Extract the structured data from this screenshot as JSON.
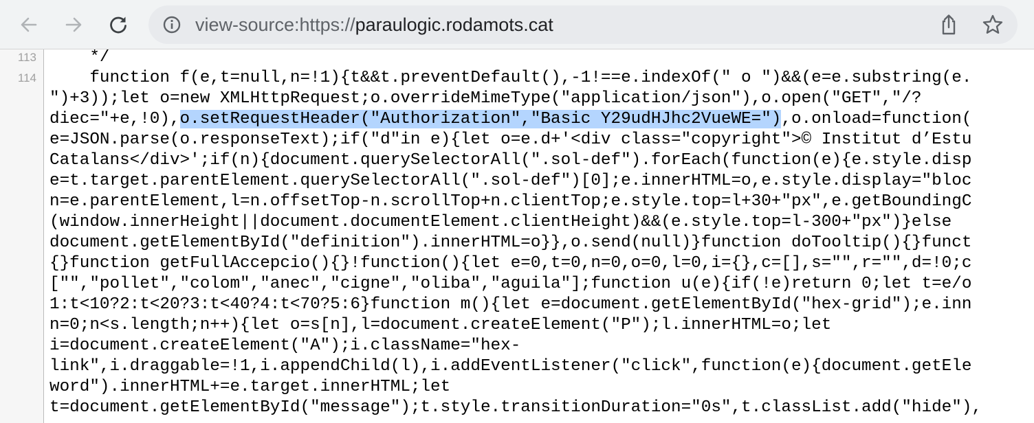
{
  "toolbar": {
    "back_icon": "arrow-left-icon",
    "forward_icon": "arrow-right-icon",
    "reload_icon": "reload-icon"
  },
  "omnibox": {
    "info_icon": "info-icon",
    "url_prefix": "view-source:https://",
    "url_host": "paraulogic.rodamots.cat",
    "share_icon": "share-icon",
    "star_icon": "star-icon"
  },
  "source": {
    "line_numbers": [
      "113",
      "114"
    ],
    "lines": [
      "    */",
      "    function f(e,t=null,n=!1){t&&t.preventDefault(),-1!==e.indexOf(\" o \")&&(e=e.substring(e.",
      "\")+3));let o=new XMLHttpRequest;o.overrideMimeType(\"application/json\"),o.open(\"GET\",\"/?",
      "diec=\"+e,!0),",
      "e=JSON.parse(o.responseText);if(\"d\"in e){let o=e.d+'<div class=\"copyright\">© Institut d’Estu",
      "Catalans</div>';if(n){document.querySelectorAll(\".sol-def\").forEach(function(e){e.style.disp",
      "e=t.target.parentElement.querySelectorAll(\".sol-def\")[0];e.innerHTML=o,e.style.display=\"bloc",
      "n=e.parentElement,l=n.offsetTop-n.scrollTop+n.clientTop;e.style.top=l+30+\"px\",e.getBoundingC",
      "(window.innerHeight||document.documentElement.clientHeight)&&(e.style.top=l-300+\"px\")}else",
      "document.getElementById(\"definition\").innerHTML=o}},o.send(null)}function doTooltip(){}funct",
      "{}function getFullAccepcio(){}!function(){let e=0,t=0,n=0,o=0,l=0,i={},c=[],s=\"\",r=\"\",d=!0;c",
      "[\"\",\"pollet\",\"colom\",\"anec\",\"cigne\",\"oliba\",\"aguila\"];function u(e){if(!e)return 0;let t=e/o",
      "1:t<10?2:t<20?3:t<40?4:t<70?5:6}function m(){let e=document.getElementById(\"hex-grid\");e.inn",
      "n=0;n<s.length;n++){let o=s[n],l=document.createElement(\"P\");l.innerHTML=o;let",
      "i=document.createElement(\"A\");i.className=\"hex-",
      "link\",i.draggable=!1,i.appendChild(l),i.addEventListener(\"click\",function(e){document.getEle",
      "word\").innerHTML+=e.target.innerHTML;let",
      "t=document.getElementById(\"message\");t.style.transitionDuration=\"0s\",t.classList.add(\"hide\"),"
    ],
    "highlighted": "o.setRequestHeader(\"Authorization\",\"Basic Y29udHJhc2VueWE=\")",
    "after_highlight": ",o.onload=function("
  }
}
